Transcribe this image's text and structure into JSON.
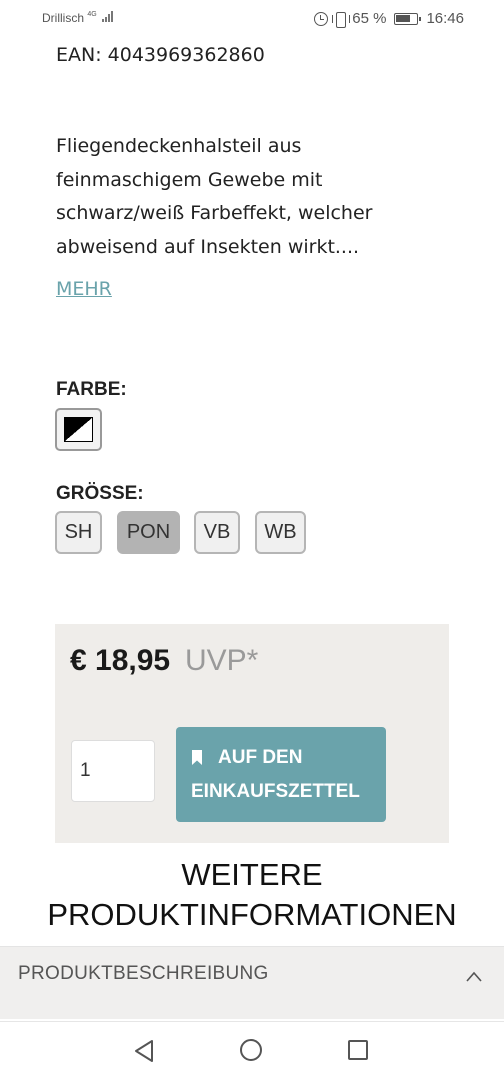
{
  "status_bar": {
    "carrier": "Drillisch",
    "network": "4G",
    "battery_percent": "65 %",
    "time": "16:46"
  },
  "product": {
    "ean": "EAN: 4043969362860",
    "description_lines": [
      "Fliegendeckenhalsteil aus",
      "feinmaschigem Gewebe mit",
      "schwarz/weiß Farbeffekt, welcher",
      "abweisend auf Insekten wirkt...."
    ],
    "more_link": "MEHR"
  },
  "color_option": {
    "label": "FARBE:",
    "swatch": "black-white diagonal",
    "selected": true
  },
  "size_option": {
    "label": "GRÖSSE:",
    "sizes": [
      {
        "label": "SH",
        "selected": false
      },
      {
        "label": "PON",
        "selected": true
      },
      {
        "label": "VB",
        "selected": false
      },
      {
        "label": "WB",
        "selected": false
      }
    ]
  },
  "purchase": {
    "price": "€ 18,95",
    "uvp": "UVP*",
    "quantity": "1",
    "cart_button_line1": "AUF DEN",
    "cart_button_line2": "EINKAUFSZETTEL",
    "cart_icon": "bookmark-icon"
  },
  "more_info": {
    "title_line1": "WEITERE",
    "title_line2": "PRODUKTINFORMATIONEN"
  },
  "accordion": {
    "label": "PRODUKTBESCHREIBUNG",
    "icon": "chevron-up-icon"
  },
  "colors": {
    "accent": "#6aa3ab",
    "price_box_bg": "#efedea",
    "selected_size_bg": "#b3b3b3"
  }
}
